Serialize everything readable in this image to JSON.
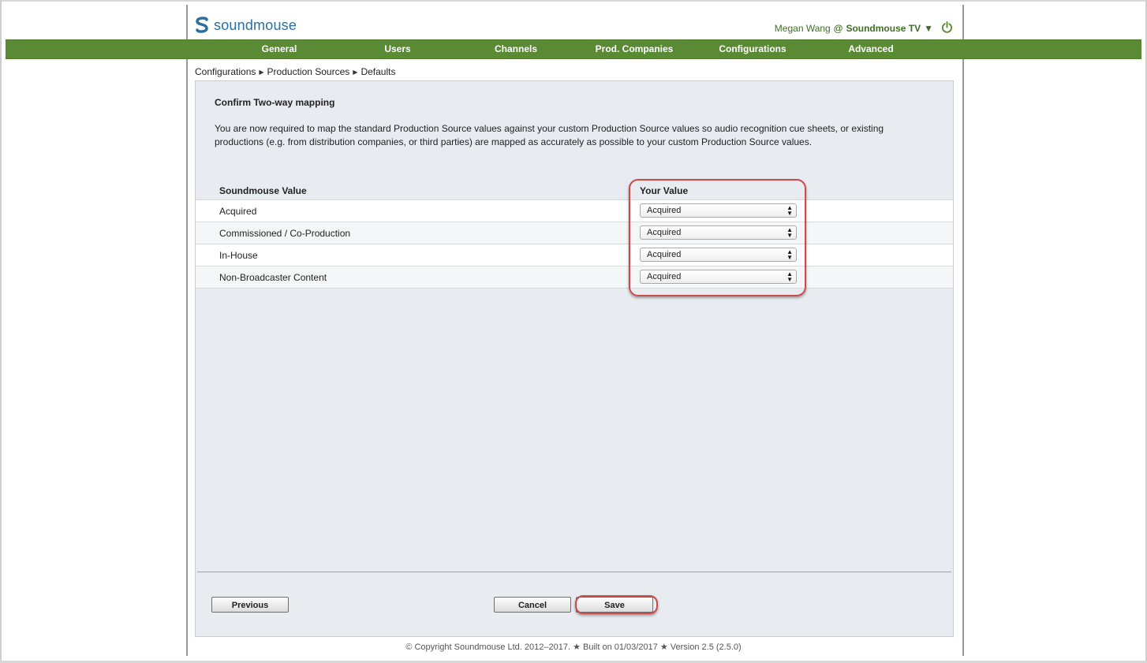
{
  "app": {
    "logo_text": "soundmouse",
    "user_name": "Megan Wang",
    "at": "@",
    "org_name": "Soundmouse TV",
    "org_dropdown": "▼"
  },
  "nav": {
    "items": [
      "General",
      "Users",
      "Channels",
      "Prod. Companies",
      "Configurations",
      "Advanced"
    ]
  },
  "breadcrumb": {
    "items": [
      "Configurations",
      "Production Sources",
      "Defaults"
    ]
  },
  "panel": {
    "title": "Confirm Two-way mapping",
    "description": "You are now required to map the standard Production Source values against your custom Production Source values so audio recognition cue sheets, or existing productions (e.g. from distribution companies, or third parties) are mapped as accurately as possible to your custom Production Source values."
  },
  "table": {
    "headers": [
      "Soundmouse Value",
      "Your Value"
    ],
    "rows": [
      {
        "label": "Acquired",
        "value": "Acquired"
      },
      {
        "label": "Commissioned / Co-Production",
        "value": "Acquired"
      },
      {
        "label": "In-House",
        "value": "Acquired"
      },
      {
        "label": "Non-Broadcaster Content",
        "value": "Acquired"
      }
    ]
  },
  "buttons": {
    "previous": "Previous",
    "cancel": "Cancel",
    "save": "Save"
  },
  "footer": {
    "text": "© Copyright Soundmouse Ltd. 2012–2017. ★ Built on 01/03/2017 ★ Version 2.5 (2.5.0)"
  },
  "colors": {
    "nav_green": "#5a8a34",
    "logo_blue": "#2d6ea0",
    "highlight_red": "#cc4a4a"
  },
  "icons": [
    "soundmouse-logo-icon",
    "power-icon",
    "breadcrumb-arrow-icon",
    "select-arrows-icon"
  ]
}
